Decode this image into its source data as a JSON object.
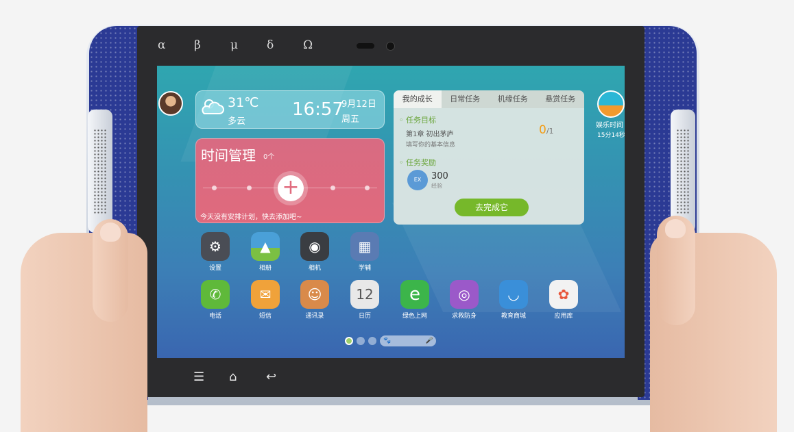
{
  "device_keys": [
    "α",
    "β",
    "μ",
    "δ",
    "Ω"
  ],
  "nav": {
    "menu_icon": "☰",
    "home_icon": "⌂",
    "back_icon": "↩"
  },
  "weather": {
    "temperature": "31℃",
    "condition": "多云",
    "time": "16:57",
    "date": "9月12日",
    "weekday": "周五"
  },
  "time_manager": {
    "title": "时间管理",
    "count": "0个",
    "add_symbol": "+",
    "hint": "今天没有安排计划，快去添加吧~"
  },
  "tasks": {
    "tabs": [
      "我的成长",
      "日常任务",
      "机缘任务",
      "悬赏任务"
    ],
    "goal_title": "任务目标",
    "chapter": "第1章  初出茅庐",
    "description": "填写你的基本信息",
    "progress_done": "0",
    "progress_total": "/1",
    "reward_title": "任务奖励",
    "reward_badge": "EX",
    "reward_value": "300",
    "reward_label": "经验",
    "action_label": "去完成它"
  },
  "entertainment": {
    "label": "娱乐时间",
    "time": "15分14秒"
  },
  "apps_row1": [
    {
      "name": "设置",
      "icon": "gear-icon",
      "color": "#4a4d55",
      "glyph": "⚙"
    },
    {
      "name": "相册",
      "icon": "gallery-icon",
      "color": "#4aa0d8",
      "glyph": "▲"
    },
    {
      "name": "相机",
      "icon": "camera-icon",
      "color": "#3a3d42",
      "glyph": "◉"
    },
    {
      "name": "学辅",
      "icon": "study-folder-icon",
      "color": "#5a7bb3",
      "glyph": "▦"
    }
  ],
  "apps_row2": [
    {
      "name": "电话",
      "icon": "phone-icon",
      "color": "#5fb93a",
      "glyph": "✆"
    },
    {
      "name": "短信",
      "icon": "message-icon",
      "color": "#f0a23a",
      "glyph": "✉"
    },
    {
      "name": "通讯录",
      "icon": "contacts-icon",
      "color": "#d98a4a",
      "glyph": "☺"
    },
    {
      "name": "日历",
      "icon": "calendar-icon",
      "color": "#e8e8e8",
      "glyph": "12"
    },
    {
      "name": "绿色上网",
      "icon": "browser-icon",
      "color": "#3cb54a",
      "glyph": "e"
    },
    {
      "name": "求救防身",
      "icon": "lifebuoy-icon",
      "color": "#9b59c9",
      "glyph": "◎"
    },
    {
      "name": "教育商城",
      "icon": "shopping-bag-icon",
      "color": "#3a8fd9",
      "glyph": "◡"
    },
    {
      "name": "应用库",
      "icon": "app-library-icon",
      "color": "#f2f2f2",
      "glyph": "✿"
    }
  ],
  "dock": {
    "search_icon": "🐾",
    "mic_icon": "🎤"
  }
}
